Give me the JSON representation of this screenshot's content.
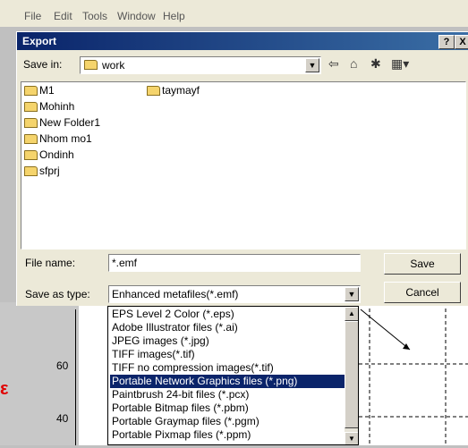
{
  "menu": [
    "File",
    "Edit",
    "Tools",
    "Window",
    "Help"
  ],
  "dialog": {
    "title": "Export",
    "help_btn": "?",
    "close_btn": "X",
    "save_in_label": "Save in:",
    "save_in_value": "work",
    "files_col1": [
      "M1",
      "Mohinh",
      "New Folder1",
      "Nhom mo1",
      "Ondinh",
      "sfprj"
    ],
    "files_col2": [
      "taymayf"
    ],
    "file_name_label": "File name:",
    "file_name_value": "*.emf",
    "save_type_label": "Save as type:",
    "save_type_value": "Enhanced metafiles(*.emf)",
    "save_button": "Save",
    "cancel_button": "Cancel"
  },
  "type_options": [
    "EPS Level 2 Color (*.eps)",
    "Adobe Illustrator files (*.ai)",
    "JPEG images (*.jpg)",
    "TIFF images(*.tif)",
    "TIFF no compression images(*.tif)",
    "Portable Network Graphics files (*.png)",
    "Paintbrush 24-bit files (*.pcx)",
    "Portable Bitmap files (*.pbm)",
    "Portable Graymap files (*.pgm)",
    "Portable Pixmap files (*.ppm)"
  ],
  "selected_option_index": 5,
  "plot": {
    "yticks": [
      "60",
      "40"
    ]
  },
  "colors": {
    "titlebar": "#0a246a",
    "selection": "#0a246a",
    "folder": "#f5d46c"
  }
}
